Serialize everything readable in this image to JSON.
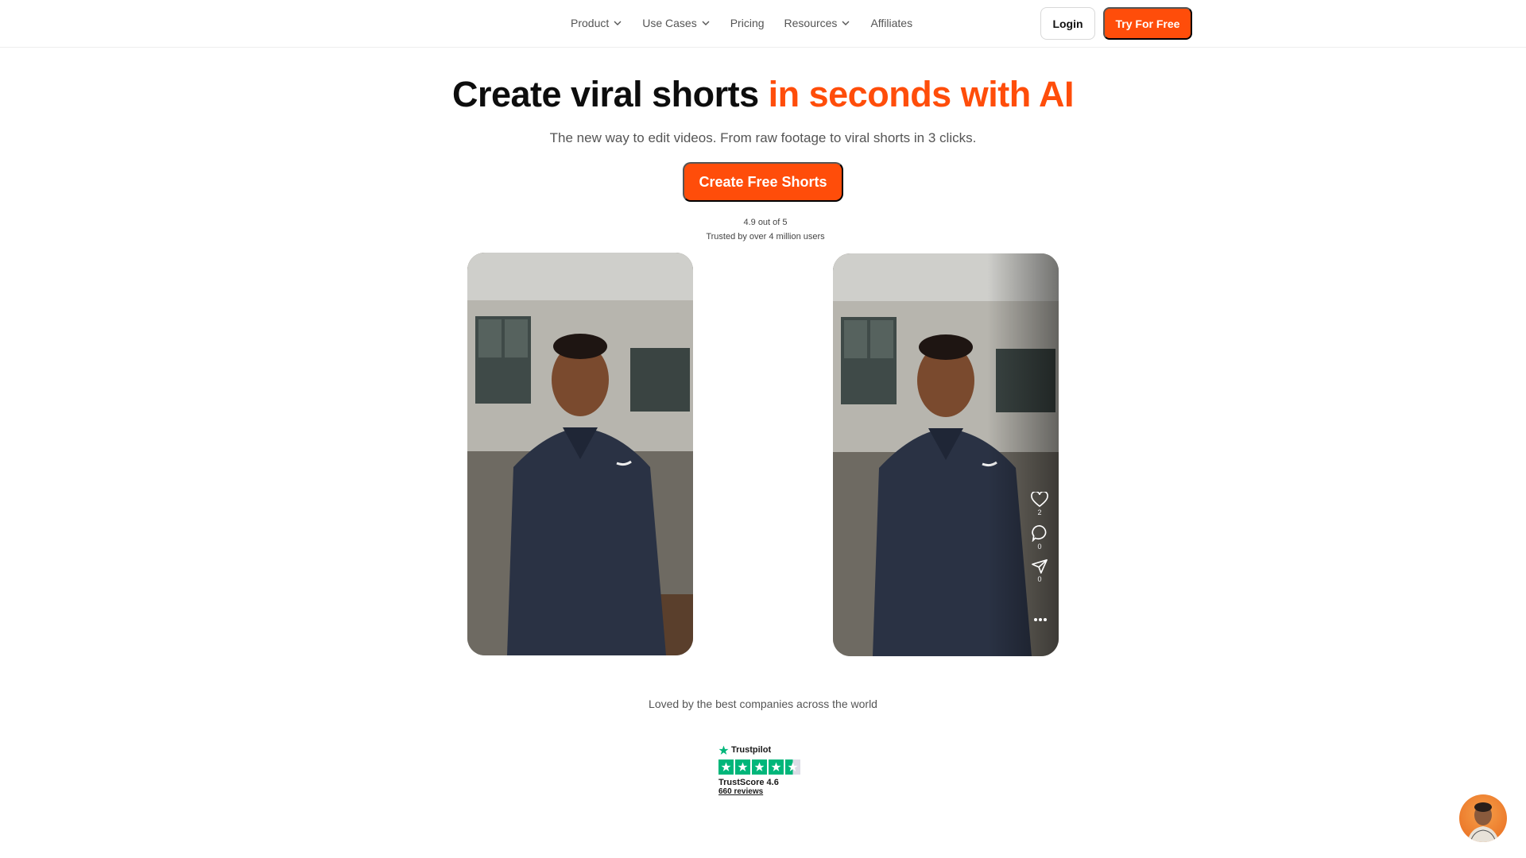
{
  "nav": {
    "items": [
      {
        "label": "Product",
        "has_dropdown": true
      },
      {
        "label": "Use Cases",
        "has_dropdown": true
      },
      {
        "label": "Pricing",
        "has_dropdown": false
      },
      {
        "label": "Resources",
        "has_dropdown": true
      },
      {
        "label": "Affiliates",
        "has_dropdown": false
      }
    ],
    "login_label": "Login",
    "try_label": "Try For Free"
  },
  "hero": {
    "headline_dark": "Create viral shorts ",
    "headline_accent": "in seconds with AI",
    "subheadline": "The new way to edit videos. From raw footage to viral shorts in 3 clicks.",
    "cta_label": "Create Free Shorts",
    "rating_line": "4.9 out of 5",
    "trust_line": "Trusted by over 4 million users"
  },
  "videos": {
    "right_actions": [
      {
        "icon": "heart-icon",
        "count": "2"
      },
      {
        "icon": "comment-icon",
        "count": "0"
      },
      {
        "icon": "share-icon",
        "count": "0"
      }
    ]
  },
  "companies": {
    "text": "Loved by the best companies across the world"
  },
  "trustpilot": {
    "brand": "Trustpilot",
    "score_text": "TrustScore 4.6",
    "reviews_text": "660 reviews",
    "stars": 4.5
  },
  "colors": {
    "accent": "#ff4d0a",
    "trustpilot_green": "#00b67a"
  }
}
